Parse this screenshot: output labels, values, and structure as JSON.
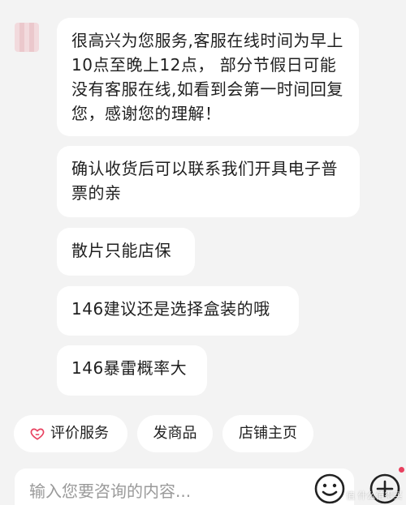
{
  "messages": [
    "很高兴为您服务,客服在线时间为早上10点至晚上12点， 部分节假日可能没有客服在线,如看到会第一时间回复您，感谢您的理解！",
    "确认收货后可以联系我们开具电子普票的亲",
    "散片只能店保",
    "146建议还是选择盒装的哦",
    "146暴雷概率大"
  ],
  "quick_actions": {
    "rate_service": "评价服务",
    "send_product": "发商品",
    "store_home": "店铺主页"
  },
  "input": {
    "placeholder": "输入您要咨询的内容..."
  },
  "icons": {
    "heart": "heart-icon",
    "emoji": "smile-icon",
    "add": "plus-icon"
  },
  "colors": {
    "accent": "#e8415f",
    "bubble": "#ffffff",
    "background": "#f3f3f3"
  },
  "watermark": "值 什么值得买"
}
